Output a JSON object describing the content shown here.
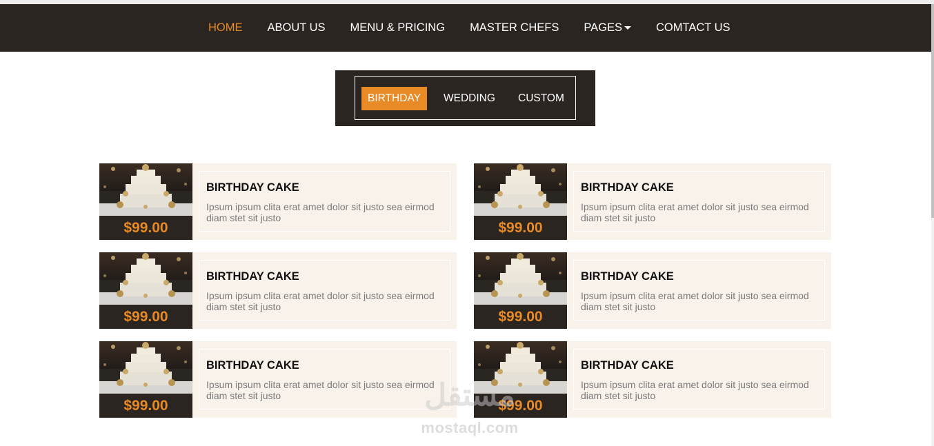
{
  "nav": {
    "items": [
      {
        "label": "HOME",
        "active": true
      },
      {
        "label": "ABOUT US",
        "active": false
      },
      {
        "label": "MENU & PRICING",
        "active": false
      },
      {
        "label": "MASTER CHEFS",
        "active": false
      },
      {
        "label": "PAGES",
        "active": false,
        "dropdown": true
      },
      {
        "label": "COMTACT US",
        "active": false
      }
    ]
  },
  "tabs": [
    {
      "label": "BIRTHDAY",
      "active": true
    },
    {
      "label": "WEDDING",
      "active": false
    },
    {
      "label": "CUSTOM",
      "active": false
    }
  ],
  "cards": [
    {
      "title": "BIRTHDAY CAKE",
      "price": "$99.00",
      "description": "Ipsum ipsum clita erat amet dolor sit justo sea eirmod diam stet sit justo"
    },
    {
      "title": "BIRTHDAY CAKE",
      "price": "$99.00",
      "description": "Ipsum ipsum clita erat amet dolor sit justo sea eirmod diam stet sit justo"
    },
    {
      "title": "BIRTHDAY CAKE",
      "price": "$99.00",
      "description": "Ipsum ipsum clita erat amet dolor sit justo sea eirmod diam stet sit justo"
    },
    {
      "title": "BIRTHDAY CAKE",
      "price": "$99.00",
      "description": "Ipsum ipsum clita erat amet dolor sit justo sea eirmod diam stet sit justo"
    },
    {
      "title": "BIRTHDAY CAKE",
      "price": "$99.00",
      "description": "Ipsum ipsum clita erat amet dolor sit justo sea eirmod diam stet sit justo"
    },
    {
      "title": "BIRTHDAY CAKE",
      "price": "$99.00",
      "description": "Ipsum ipsum clita erat amet dolor sit justo sea eirmod diam stet sit justo"
    }
  ],
  "watermark": {
    "arabic": "مستقل",
    "latin": "mostaql.com"
  },
  "colors": {
    "accent": "#e88a25",
    "dark": "#2b2522",
    "card_bg": "#f9f2eb"
  }
}
